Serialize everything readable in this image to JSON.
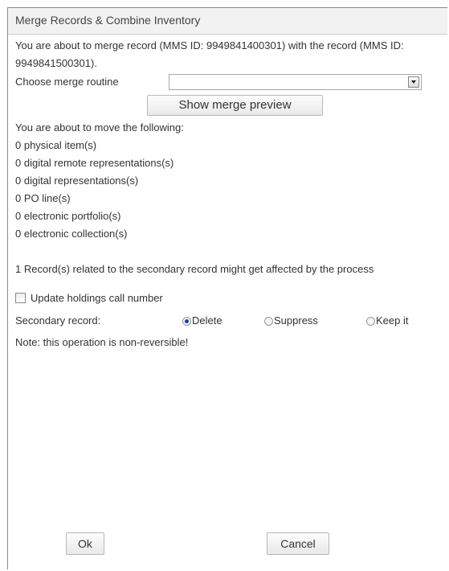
{
  "dialog": {
    "title": "Merge Records & Combine Inventory",
    "intro": "You are about to merge record (MMS ID: 9949841400301) with the record (MMS ID: 9949841500301).",
    "routine_label": "Choose merge routine",
    "routine_selected": "",
    "preview_button": "Show merge preview",
    "move_heading": "You are about to move the following:",
    "move_items": [
      "0 physical item(s)",
      "0 digital remote representations(s)",
      "0 digital representations(s)",
      "0 PO line(s)",
      "0 electronic portfolio(s)",
      "0 electronic collection(s)"
    ],
    "related_note": "1 Record(s) related to the secondary record might get affected by the process",
    "update_holdings_label": "Update holdings call number",
    "update_holdings_checked": false,
    "secondary_label": "Secondary record:",
    "secondary_options": [
      "Delete",
      "Suppress",
      "Keep it"
    ],
    "secondary_selected": "Delete",
    "warning": "Note: this operation is non-reversible!",
    "ok_button": "Ok",
    "cancel_button": "Cancel"
  },
  "colors": {
    "titlebar_bg": "#f2f2f2",
    "border": "#8a8a8a",
    "text": "#333333",
    "radio_selected": "#1f3f8f"
  }
}
